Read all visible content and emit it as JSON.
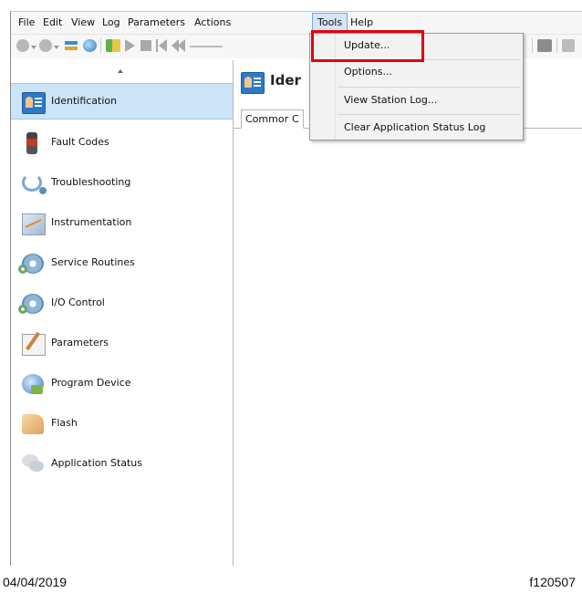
{
  "menubar": {
    "items": [
      {
        "label": "File"
      },
      {
        "label": "Edit"
      },
      {
        "label": "View"
      },
      {
        "label": "Log"
      },
      {
        "label": "Parameters"
      },
      {
        "label": "Actions"
      },
      {
        "label": "Tools"
      },
      {
        "label": "Help"
      }
    ]
  },
  "tools_menu": {
    "items": [
      {
        "label": "Update..."
      },
      {
        "label": "Options..."
      },
      {
        "label": "View Station Log..."
      },
      {
        "label": "Clear Application Status Log"
      }
    ],
    "highlight_color": "#e3000f"
  },
  "sidebar": {
    "items": [
      {
        "label": "Identification",
        "icon": "id-card-icon",
        "selected": true
      },
      {
        "label": "Fault Codes",
        "icon": "fault-codes-icon"
      },
      {
        "label": "Troubleshooting",
        "icon": "stethoscope-icon"
      },
      {
        "label": "Instrumentation",
        "icon": "gauge-chart-icon"
      },
      {
        "label": "Service Routines",
        "icon": "gears-icon"
      },
      {
        "label": "I/O Control",
        "icon": "io-gears-icon"
      },
      {
        "label": "Parameters",
        "icon": "parameters-icon"
      },
      {
        "label": "Program Device",
        "icon": "program-device-icon"
      },
      {
        "label": "Flash",
        "icon": "flash-icon"
      },
      {
        "label": "Application Status",
        "icon": "chat-bubbles-icon"
      }
    ],
    "selected_color": "#cce4f7"
  },
  "main": {
    "title": "Ider",
    "tabs": [
      {
        "label": "Common"
      },
      {
        "label": "C"
      }
    ]
  },
  "footer": {
    "date": "04/04/2019",
    "figure_id": "f120507"
  }
}
